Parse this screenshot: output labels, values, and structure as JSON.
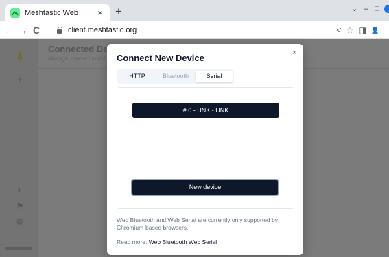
{
  "browser": {
    "tab_title": "Meshtastic Web",
    "tab_close": "×",
    "new_tab": "+",
    "url": "client.meshtastic.org",
    "nav": {
      "back": "←",
      "forward": "→",
      "reload": "C"
    },
    "window_controls": {
      "menu": "⌄",
      "minimize": "–",
      "maximize": "□"
    },
    "toolbar_icons": {
      "share": "<",
      "bookmark": "☆",
      "sidepanel": "◨",
      "profile": "👤"
    }
  },
  "background": {
    "title": "Connected Devices",
    "subtitle": "Manage, connect and disconnect devices"
  },
  "modal": {
    "title": "Connect New Device",
    "close": "×",
    "tabs": [
      {
        "label": "HTTP",
        "state": "normal"
      },
      {
        "label": "Bluetooth",
        "state": "disabled"
      },
      {
        "label": "Serial",
        "state": "active"
      }
    ],
    "serial": {
      "device_label": "# 0 - UNK - UNK",
      "new_device_label": "New device"
    },
    "note": "Web Bluetooth and Web Serial are currently only supported by Chromium-based browsers.",
    "read_more": {
      "prefix": "Read more:",
      "links": [
        "Web Bluetooth",
        "Web Serial"
      ]
    }
  },
  "colors": {
    "accent": "#0f172a",
    "favicon": "#67ea94",
    "overlay": "#7b7b7b",
    "muted_text": "#64748b"
  }
}
